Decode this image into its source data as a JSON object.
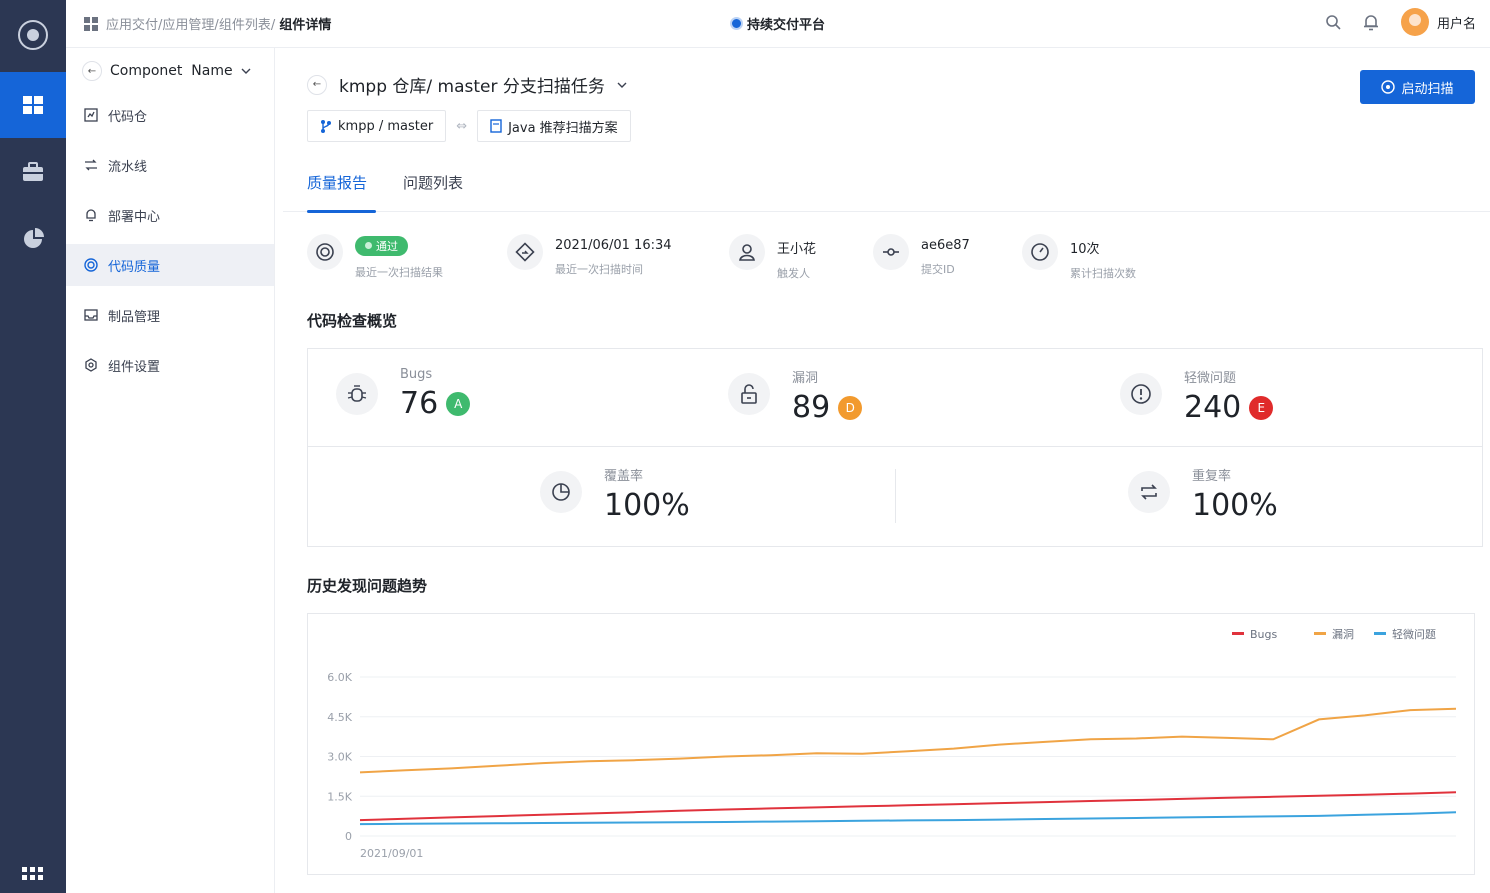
{
  "header": {
    "breadcrumb": [
      "应用交付",
      "应用管理",
      "组件列表"
    ],
    "breadcrumb_sep": "/",
    "breadcrumb_current": "组件详情",
    "platform": "持续交付平台",
    "username": "用户名"
  },
  "subnav": {
    "component_name": "Componet  Name",
    "items": [
      {
        "label": "代码仓",
        "icon": "code-repo-icon"
      },
      {
        "label": "流水线",
        "icon": "pipeline-icon"
      },
      {
        "label": "部署中心",
        "icon": "bell-icon"
      },
      {
        "label": "代码质量",
        "icon": "target-icon",
        "active": true
      },
      {
        "label": "制品管理",
        "icon": "inbox-icon"
      },
      {
        "label": "组件设置",
        "icon": "gear-icon"
      }
    ]
  },
  "main": {
    "title": "kmpp 仓库/ master 分支扫描任务",
    "scan_button": "启动扫描",
    "branch_chip": "kmpp / master",
    "plan_chip": "Java 推荐扫描方案",
    "tabs": [
      "质量报告",
      "问题列表"
    ],
    "stats": [
      {
        "value": "通过",
        "label": "最近一次扫描结果"
      },
      {
        "value": "2021/06/01 16:34",
        "label": "最近一次扫描时间"
      },
      {
        "value": "王小花",
        "label": "触发人"
      },
      {
        "value": "ae6e87",
        "label": "提交ID"
      },
      {
        "value": "10次",
        "label": "累计扫描次数"
      }
    ],
    "overview_title": "代码检查概览",
    "overview": {
      "bugs": {
        "label": "Bugs",
        "value": "76",
        "grade": "A",
        "grade_color": "#3fba6e"
      },
      "vuln": {
        "label": "漏洞",
        "value": "89",
        "grade": "D",
        "grade_color": "#f29a2e"
      },
      "minor": {
        "label": "轻微问题",
        "value": "240",
        "grade": "E",
        "grade_color": "#e02b2b"
      },
      "coverage": {
        "label": "覆盖率",
        "value": "100%"
      },
      "duplication": {
        "label": "重复率",
        "value": "100%"
      }
    },
    "trend_title": "历史发现问题趋势"
  },
  "chart_data": {
    "type": "line",
    "x": [
      "2021/09/01",
      "",
      "",
      "",
      "",
      "",
      "",
      "",
      "",
      "",
      "",
      "",
      "",
      "",
      "",
      "",
      "",
      "",
      "",
      "",
      "",
      "",
      "",
      "",
      ""
    ],
    "x_tick_label": "2021/09/01",
    "yticks": [
      "6.0K",
      "4.5K",
      "3.0K",
      "1.5K",
      "0"
    ],
    "ylim": [
      0,
      6000
    ],
    "legend_position": "top-right",
    "grid": true,
    "series": [
      {
        "name": "Bugs",
        "color": "#e0323c",
        "values": [
          600,
          650,
          700,
          750,
          800,
          850,
          900,
          950,
          1000,
          1040,
          1080,
          1120,
          1160,
          1200,
          1240,
          1280,
          1320,
          1360,
          1400,
          1440,
          1480,
          1520,
          1560,
          1600,
          1650
        ]
      },
      {
        "name": "漏洞",
        "color": "#f0a446",
        "values": [
          2400,
          2480,
          2550,
          2650,
          2750,
          2820,
          2860,
          2920,
          3000,
          3050,
          3120,
          3100,
          3200,
          3300,
          3450,
          3550,
          3650,
          3680,
          3750,
          3700,
          3650,
          4400,
          4550,
          4750,
          4800
        ]
      },
      {
        "name": "轻微问题",
        "color": "#3ba3de",
        "values": [
          450,
          460,
          470,
          480,
          490,
          500,
          510,
          520,
          530,
          545,
          560,
          575,
          590,
          600,
          620,
          640,
          660,
          680,
          700,
          720,
          740,
          760,
          800,
          840,
          900
        ]
      }
    ]
  }
}
